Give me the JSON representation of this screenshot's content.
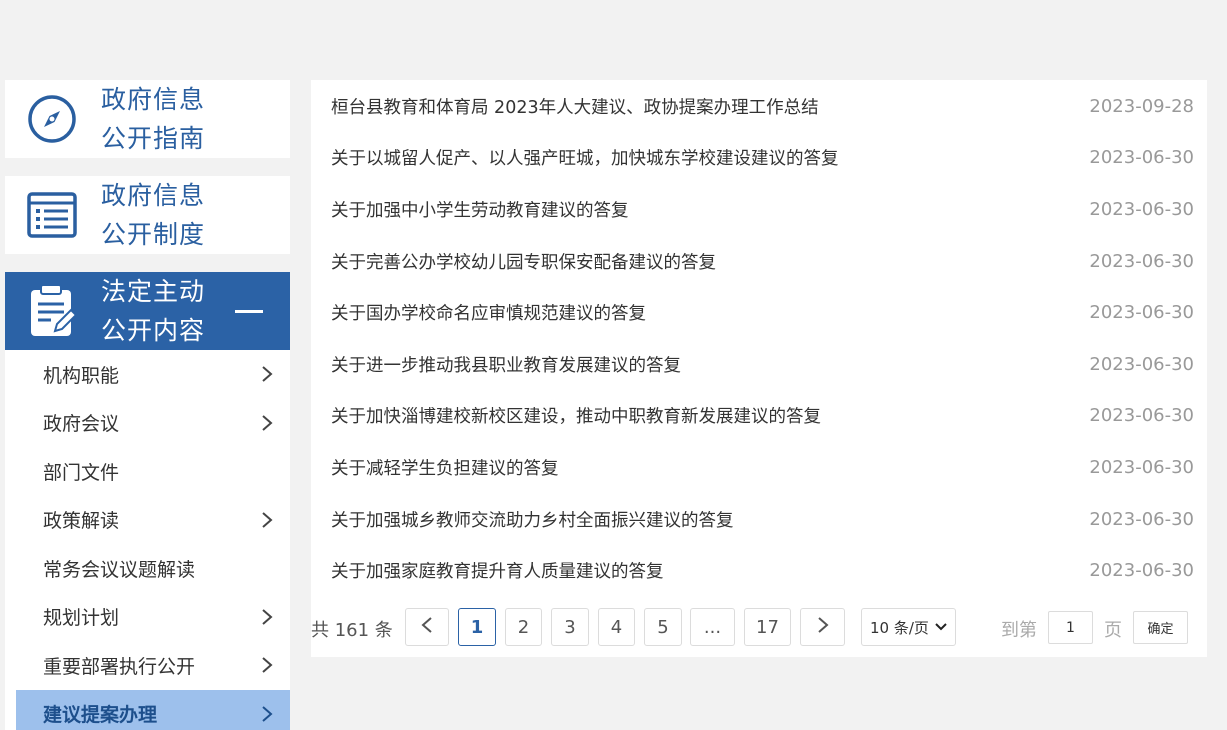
{
  "sidebar": {
    "guide": {
      "line1": "政府信息",
      "line2": "公开指南",
      "icon": "compass-icon"
    },
    "system": {
      "line1": "政府信息",
      "line2": "公开制度",
      "icon": "list-doc-icon"
    },
    "statutory": {
      "line1": "法定主动",
      "line2": "公开内容",
      "icon": "clipboard-edit-icon"
    },
    "items": [
      {
        "label": "机构职能",
        "has_arrow": true
      },
      {
        "label": "政府会议",
        "has_arrow": true
      },
      {
        "label": "部门文件",
        "has_arrow": false
      },
      {
        "label": "政策解读",
        "has_arrow": true
      },
      {
        "label": "常务会议议题解读",
        "has_arrow": false
      },
      {
        "label": "规划计划",
        "has_arrow": true
      },
      {
        "label": "重要部署执行公开",
        "has_arrow": true
      },
      {
        "label": "建议提案办理",
        "has_arrow": true,
        "selected": true
      }
    ]
  },
  "list": [
    {
      "title": "桓台县教育和体育局 2023年人大建议、政协提案办理工作总结",
      "date": "2023-09-28"
    },
    {
      "title": "关于以城留人促产、以人强产旺城，加快城东学校建设建议的答复",
      "date": "2023-06-30"
    },
    {
      "title": "关于加强中小学生劳动教育建议的答复",
      "date": "2023-06-30"
    },
    {
      "title": "关于完善公办学校幼儿园专职保安配备建议的答复",
      "date": "2023-06-30"
    },
    {
      "title": "关于国办学校命名应审慎规范建议的答复",
      "date": "2023-06-30"
    },
    {
      "title": "关于进一步推动我县职业教育发展建议的答复",
      "date": "2023-06-30"
    },
    {
      "title": "关于加快淄博建校新校区建设，推动中职教育新发展建议的答复",
      "date": "2023-06-30"
    },
    {
      "title": "关于减轻学生负担建议的答复",
      "date": "2023-06-30"
    },
    {
      "title": "关于加强城乡教师交流助力乡村全面振兴建议的答复",
      "date": "2023-06-30"
    },
    {
      "title": "关于加强家庭教育提升育人质量建议的答复",
      "date": "2023-06-30"
    }
  ],
  "pagination": {
    "total_text": "共 161 条",
    "pages": [
      "1",
      "2",
      "3",
      "4",
      "5",
      "...",
      "17"
    ],
    "current": "1",
    "page_size": "10 条/页",
    "goto_prefix": "到第",
    "goto_value": "1",
    "goto_suffix": "页",
    "confirm": "确定"
  },
  "colors": {
    "accent": "#2b62a6",
    "nav_text": "#2a5fa0",
    "selected_bg": "#9dc0ec"
  }
}
